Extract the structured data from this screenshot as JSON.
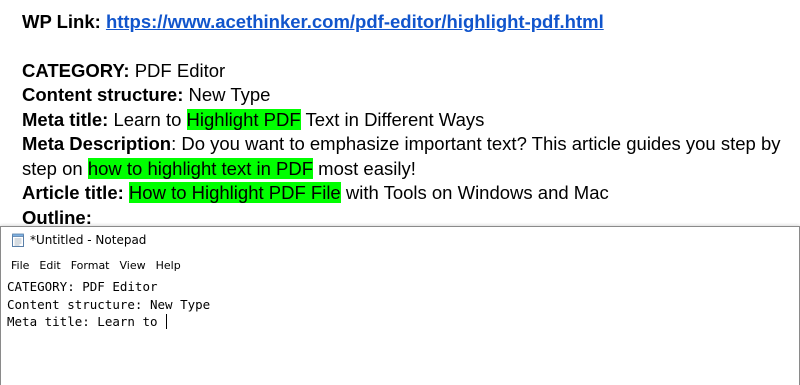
{
  "document": {
    "wp_link": {
      "label": "WP Link:",
      "url": "https://www.acethinker.com/pdf-editor/highlight-pdf.html"
    },
    "category": {
      "label": "CATEGORY:",
      "value": "PDF Editor"
    },
    "content_structure": {
      "label": "Content structure:",
      "value": "New Type"
    },
    "meta_title": {
      "label": "Meta title:",
      "before": "Learn to",
      "highlight": "Highlight PDF",
      "after": "Text in Different Ways"
    },
    "meta_description": {
      "label": "Meta Description",
      "before": ": Do you want to emphasize important text? This article guides you step by step on",
      "highlight": "how to highlight text in PDF",
      "after": "most easily!"
    },
    "article_title": {
      "label": "Article title:",
      "highlight": "How to Highlight PDF File",
      "after": "with Tools on Windows and Mac"
    },
    "outline": {
      "label": "Outline:"
    },
    "highlight_color": "#00ff00",
    "link_color": "#1155cc"
  },
  "notepad": {
    "title": "*Untitled - Notepad",
    "icon": "notepad-icon",
    "menu": [
      "File",
      "Edit",
      "Format",
      "View",
      "Help"
    ],
    "lines": [
      "CATEGORY: PDF Editor",
      "Content structure: New Type",
      "Meta title: Learn to "
    ]
  }
}
